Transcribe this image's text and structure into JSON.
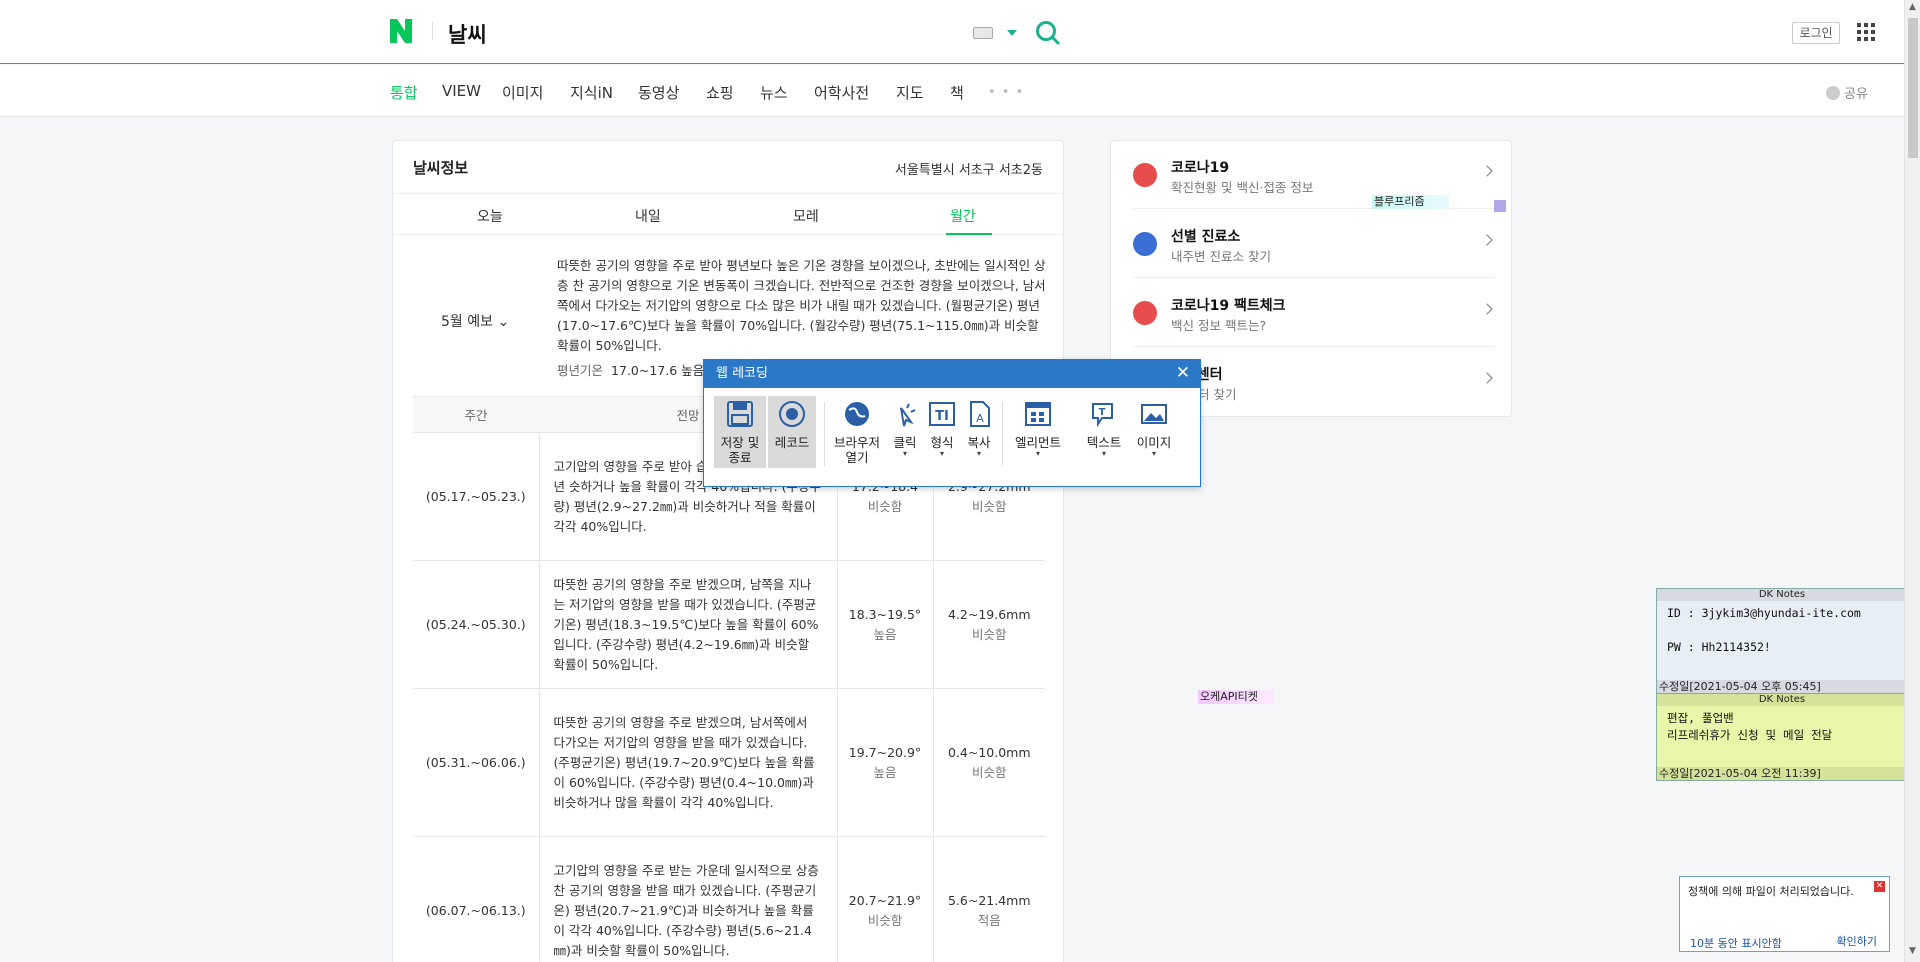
{
  "header": {
    "title": "날씨",
    "login": "로그인"
  },
  "nav": {
    "tabs": [
      "통합",
      "VIEW",
      "이미지",
      "지식iN",
      "동영상",
      "쇼핑",
      "뉴스",
      "어학사전",
      "지도",
      "책"
    ],
    "more": "• • •",
    "share": "공유"
  },
  "weather": {
    "title": "날씨정보",
    "location": "서울특별시 서초구 서초2동",
    "tabs": [
      "오늘",
      "내일",
      "모레",
      "월간"
    ],
    "month_label": "5월 예보",
    "description": "따뜻한 공기의 영향을 주로 받아 평년보다 높은 기온 경향을 보이겠으나, 초반에는 일시적인 상층 찬 공기의 영향으로 기온 변동폭이 크겠습니다. 전반적으로 건조한 경향을 보이겠으나, 남서쪽에서 다가오는 저기압의 영향으로 다소 많은 비가 내릴 때가 있겠습니다. (월평균기온) 평년(17.0~17.6℃)보다 높을 확률이 70%입니다. (월강수량) 평년(75.1~115.0㎜)과 비슷할 확률이 50%입니다.",
    "avg_label": "평년기온",
    "avg_value": "17.0~17.6 높음",
    "table_headers": [
      "주간",
      "전망"
    ],
    "rows": [
      {
        "period": "(05.17.~05.23.)",
        "forecast": "고기압의 영향을 주로 받아 습니다. (주평균기온) 평년 슷하거나 높을 확률이 각각 40%입니다. (주강수량) 평년(2.9~27.2㎜)과 비슷하거나 적을 확률이 각각 40%입니다.",
        "temp": "17.2~18.4",
        "temp_trend": "비슷함",
        "precip": "2.9~27.2mm",
        "precip_trend": "비슷함"
      },
      {
        "period": "(05.24.~05.30.)",
        "forecast": "따뜻한 공기의 영향을 주로 받겠으며, 남쪽을 지나는 저기압의 영향을 받을 때가 있겠습니다. (주평균기온) 평년(18.3~19.5℃)보다 높을 확률이 60%입니다. (주강수량) 평년(4.2~19.6㎜)과 비슷할 확률이 50%입니다.",
        "temp": "18.3~19.5°",
        "temp_trend": "높음",
        "precip": "4.2~19.6mm",
        "precip_trend": "비슷함"
      },
      {
        "period": "(05.31.~06.06.)",
        "forecast": "따뜻한 공기의 영향을 주로 받겠으며, 남서쪽에서 다가오는 저기압의 영향을 받을 때가 있겠습니다. (주평균기온) 평년(19.7~20.9℃)보다 높을 확률이 60%입니다. (주강수량) 평년(0.4~10.0㎜)과 비슷하거나 많을 확률이 각각 40%입니다.",
        "temp": "19.7~20.9°",
        "temp_trend": "높음",
        "precip": "0.4~10.0mm",
        "precip_trend": "비슷함"
      },
      {
        "period": "(06.07.~06.13.)",
        "forecast": "고기압의 영향을 주로 받는 가운데 일시적으로 상층 찬 공기의 영향을 받을 때가 있겠습니다. (주평균기온) 평년(20.7~21.9℃)과 비슷하거나 높을 확률이 각각 40%입니다. (주강수량) 평년(5.6~21.4㎜)과 비슷할 확률이 50%입니다.",
        "temp": "20.7~21.9°",
        "temp_trend": "비슷함",
        "precip": "5.6~21.4mm",
        "precip_trend": "적음"
      }
    ]
  },
  "covid": {
    "items": [
      {
        "title": "코로나19",
        "sub": "확진현황 및 백신·접종 정보",
        "color": "#e84d4d"
      },
      {
        "title": "선별 진료소",
        "sub": "내주변 진료소 찾기",
        "color": "#3b6fd6"
      },
      {
        "title": "코로나19 팩트체크",
        "sub": "백신 정보 팩트는?",
        "color": "#e84d4d"
      },
      {
        "title": "접종센터",
        "sub": "변 센터 찾기",
        "color": "#3b6fd6"
      }
    ]
  },
  "extension_tags": {
    "tag1": "블루프리즘",
    "tag2": "오케API티켓"
  },
  "recorder": {
    "title": "웹 레코딩",
    "tools": [
      {
        "label": "저장 및\n종료",
        "icon": "save-icon"
      },
      {
        "label": "레코드",
        "icon": "record-icon"
      },
      {
        "label": "브라우저\n열기",
        "icon": "globe-icon"
      },
      {
        "label": "클릭",
        "icon": "click-icon"
      },
      {
        "label": "형식",
        "icon": "type-icon"
      },
      {
        "label": "복사",
        "icon": "copy-icon"
      },
      {
        "label": "엘리먼트",
        "icon": "element-icon"
      },
      {
        "label": "텍스트",
        "icon": "text-icon"
      },
      {
        "label": "이미지",
        "icon": "image-icon"
      }
    ]
  },
  "notes": [
    {
      "title": "DK Notes",
      "body": "ID : 3jykim3@hyundai-ite.com\n\nPW : Hh2114352!",
      "footer": "수정일[2021-05-04 오후 05:45]"
    },
    {
      "title": "DK Notes",
      "body": "편잡, 풀업밴\n리프레쉬휴가 신청 및 메일 전달",
      "footer": "수정일[2021-05-04 오전 11:39]"
    }
  ],
  "policy": {
    "message": "정책에 의해 파일이 처리되었습니다.",
    "hide": "10분 동안 표시안함",
    "confirm": "확인하기"
  },
  "colors": {
    "accent": "#03c75a",
    "dialog": "#2b78c9"
  }
}
